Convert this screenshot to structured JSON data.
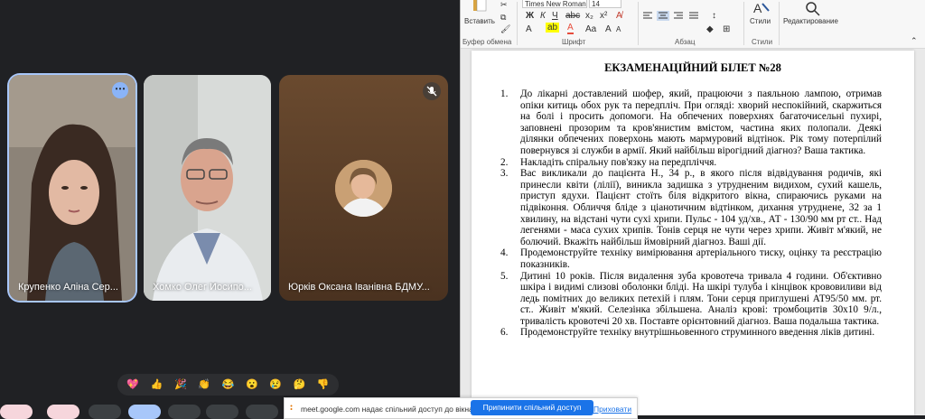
{
  "meet": {
    "participants": [
      {
        "name": "Крупенко Аліна Сер..."
      },
      {
        "name": "Хомко Олег Йосипо..."
      },
      {
        "name": "Юрків Оксана Іванівна БДМУ..."
      }
    ],
    "reactions": [
      "💖",
      "👍",
      "🎉",
      "👏",
      "😂",
      "😮",
      "😢",
      "🤔",
      "👎"
    ],
    "colors": {
      "background": "#202124",
      "active_border": "#a8c7fa"
    }
  },
  "share_bar": {
    "text": "meet.google.com надає спільний доступ до вікна.",
    "stop_label": "Припинити спільний доступ",
    "hide_label": "Приховати"
  },
  "word": {
    "ribbon": {
      "paste_label": "Вставить",
      "clipboard_label": "Буфер обмена",
      "font_group_label": "Шрифт",
      "paragraph_group_label": "Абзац",
      "styles_group_label": "Стили",
      "styles_label": "Стили",
      "editing_label": "Редактирование",
      "font_name": "Times New Roman",
      "font_size": "14"
    },
    "document": {
      "title": "ЕКЗАМЕНАЦІЙНИЙ БІЛЕТ №28",
      "items": [
        {
          "num": "1.",
          "text": "До лікарні доставлений шофер, який, працюючи з паяльною лампою, отримав опіки китиць обох рук та передпліч. При огляді: хворий неспокійний, скаржиться на болі і просить допомоги. На обпечених поверхнях багаточисельні пухирі, заповнені прозорим та кров'янистим вмістом, частина яких полопали. Деякі ділянки обпечених поверхонь мають мармуровий відтінок. Рік тому потерпілий повернувся зі служби в армії. Який найбільш вірогідний діагноз? Ваша тактика."
        },
        {
          "num": "2.",
          "text": "Накладіть спіральну пов'язку на передпліччя."
        },
        {
          "num": "3.",
          "text": "Вас викликали до пацієнта Н., 34 р., в якого після відвідування родичів, які принесли квіти (лілії), виникла задишка з утрудненим видихом, сухий кашель, приступ ядухи. Пацієнт стоїть біля відкритого вікна, спираючись руками на підвіконня. Обличчя бліде з ціанотичним відтінком, дихання утруднене, 32 за 1 хвилину, на відстані чути сухі хрипи. Пульс - 104 уд/хв., АТ - 130/90 мм рт ст.. Над легенями - маса сухих хрипів. Тонів серця не чути через хрипи. Живіт м'який, не болючий. Вкажіть найбільш ймовірний діагноз. Ваші дії."
        },
        {
          "num": "4.",
          "text": "Продемонструйте техніку вимірювання артеріального тиску, оцінку та реєстрацію показників."
        },
        {
          "num": "5.",
          "text": "Дитині 10 років. Після видалення зуба кровотеча тривала 4 години. Об'єктивно шкіра і видимі слизові оболонки бліді. На шкірі тулуба і кінцівок крововиливи від ледь помітних до великих петехій і плям. Тони серця приглушені АТ95/50 мм. рт. ст.. Живіт м'який. Селезінка збільшена. Аналіз крові: тромбоцитів 30х10 9/л., тривалість кровотечі 20 хв. Поставте орієнтовний діагноз. Ваша подальша тактика."
        },
        {
          "num": "6.",
          "text": "Продемонструйте техніку внутрішньовенного струминного введення ліків дитині."
        }
      ]
    }
  }
}
